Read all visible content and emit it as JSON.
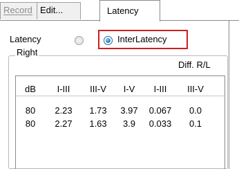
{
  "tabs": [
    {
      "label": "Record",
      "state": "disabled"
    },
    {
      "label": "Edit...",
      "state": "normal"
    },
    {
      "label": "Latency",
      "state": "active"
    }
  ],
  "mode": {
    "latency_label": "Latency",
    "interlatency_label": "InterLatency",
    "selected": "InterLatency",
    "highlight_color": "#cc1f1f"
  },
  "group": {
    "title": "Right",
    "diff_label": "Diff. R/L"
  },
  "table": {
    "columns": [
      "dB",
      "I-III",
      "III-V",
      "I-V",
      "I-III",
      "III-V"
    ],
    "rows": [
      [
        "80",
        "2.23",
        "1.73",
        "3.97",
        "0.067",
        "0.0"
      ],
      [
        "80",
        "2.27",
        "1.63",
        "3.9",
        "0.033",
        "0.1"
      ]
    ]
  }
}
